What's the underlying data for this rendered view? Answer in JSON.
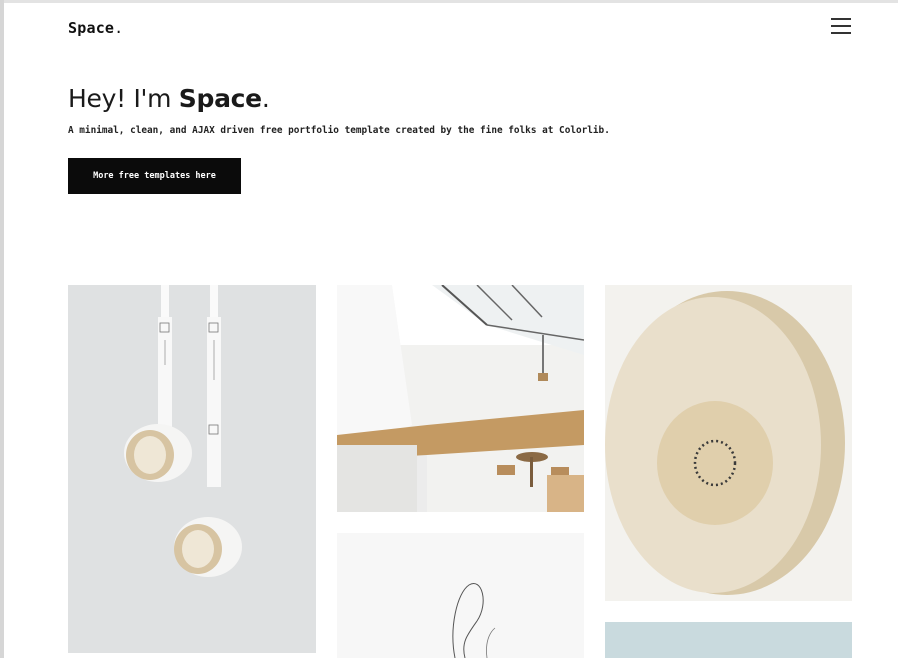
{
  "header": {
    "logo_text": "Space",
    "logo_dot": ".",
    "menu_icon": "hamburger-menu-icon"
  },
  "hero": {
    "title_prefix": "Hey! I'm ",
    "title_bold": "Space",
    "title_suffix": ".",
    "subtitle": "A minimal, clean, and AJAX driven free portfolio template created by the fine folks at Colorlib.",
    "cta_label": "More free templates here"
  },
  "gallery": {
    "items": [
      {
        "subject": "tape-rolls-photo"
      },
      {
        "subject": "cafe-interior-photo"
      },
      {
        "subject": "round-tin-photo"
      },
      {
        "subject": "line-drawing-photo"
      },
      {
        "subject": "blue-gray-photo"
      }
    ]
  },
  "colors": {
    "background": "#ffffff",
    "button_bg": "#0b0b0b",
    "button_text": "#ffffff",
    "text": "#111111"
  }
}
